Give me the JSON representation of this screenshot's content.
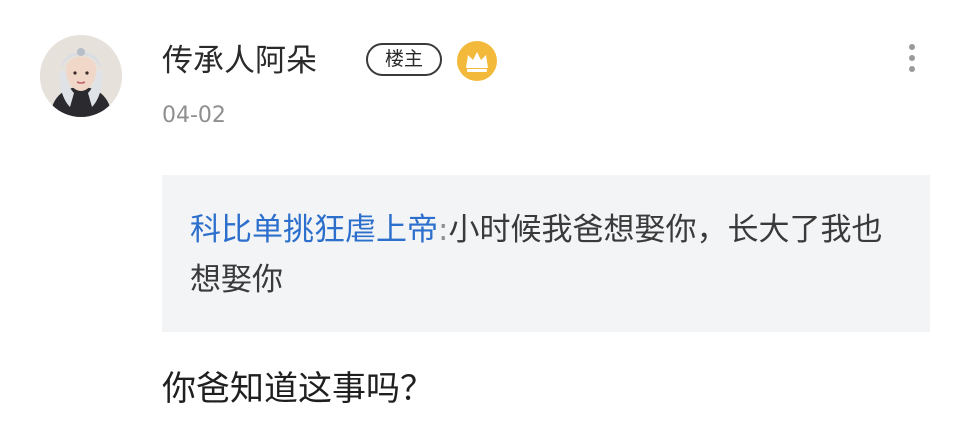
{
  "comment": {
    "author_name": "传承人阿朵",
    "op_badge_label": "楼主",
    "crown_icon": "crown-icon",
    "timestamp": "04-02",
    "more_icon": "more-vertical-icon",
    "avatar": "avatar-image",
    "quote": {
      "author": "科比单挑狂虐上帝",
      "separator": ":",
      "text": "小时候我爸想娶你，长大了我也想娶你"
    },
    "reply_text": "你爸知道这事吗？"
  },
  "colors": {
    "author_link": "#2c6fcc",
    "crown_badge": "#f3b93a",
    "quote_background": "#f3f4f6",
    "timestamp": "#8f8f8f"
  }
}
